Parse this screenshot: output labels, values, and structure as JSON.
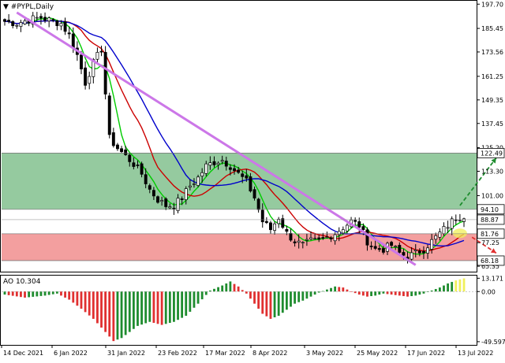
{
  "chart_data": [
    {
      "type": "candlestick",
      "title": "▼ #PYPL,Daily",
      "ylim": [
        63.0,
        199.0
      ],
      "yticks": [
        "197.70",
        "185.45",
        "173.56",
        "161.25",
        "149.35",
        "137.45",
        "125.20",
        "113.30",
        "101.00",
        "89.10",
        "77.25",
        "65.35"
      ],
      "yticks_values": [
        197.7,
        185.45,
        173.56,
        161.25,
        149.35,
        137.45,
        125.2,
        113.3,
        101.0,
        89.1,
        77.25,
        65.35
      ],
      "price_labels": [
        {
          "label": "122.49",
          "value": 122.49,
          "color": "#ffffff",
          "text_color": "#000000"
        },
        {
          "label": "94.10",
          "value": 94.1,
          "color": "#ffffff",
          "text_color": "#000000"
        },
        {
          "label": "88.87",
          "value": 88.87,
          "color": "#ffffff",
          "text_color": "#000000"
        },
        {
          "label": "81.76",
          "value": 81.76,
          "color": "#ffffff",
          "text_color": "#000000"
        },
        {
          "label": "68.18",
          "value": 68.18,
          "color": "#ffffff",
          "text_color": "#000000"
        }
      ],
      "zones": [
        {
          "name": "resistance",
          "from": 94.1,
          "to": 122.49,
          "color": "#8fc79a"
        },
        {
          "name": "support",
          "from": 68.18,
          "to": 81.76,
          "color": "#f29a9a"
        }
      ],
      "trendline": {
        "from": [
          3,
          193.5
        ],
        "to": [
          102,
          66.0
        ],
        "color": "#cc77e8"
      },
      "forecast_arrows": [
        {
          "from": [
            113,
            96.0
          ],
          "to": [
            122,
            120.0
          ],
          "color": "#1e8c2e"
        },
        {
          "from": [
            116,
            80.0
          ],
          "to": [
            122,
            72.0
          ],
          "color": "#e03030"
        }
      ],
      "moving_averages": [
        {
          "color": "#00cc00"
        },
        {
          "color": "#cc0000"
        },
        {
          "color": "#0000cc"
        }
      ],
      "series": [
        {
          "name": "price",
          "anchors": [
            [
              0,
              189
            ],
            [
              3,
              188
            ],
            [
              6,
              190
            ],
            [
              9,
              191
            ],
            [
              12,
              189
            ],
            [
              14,
              188
            ],
            [
              16,
              182
            ],
            [
              18,
              172
            ],
            [
              20,
              158
            ],
            [
              22,
              168
            ],
            [
              24,
              175
            ],
            [
              26,
              130
            ],
            [
              28,
              125
            ],
            [
              30,
              121
            ],
            [
              32,
              117
            ],
            [
              34,
              112
            ],
            [
              36,
              104
            ],
            [
              38,
              99
            ],
            [
              40,
              96
            ],
            [
              42,
              96
            ],
            [
              44,
              100
            ],
            [
              46,
              106
            ],
            [
              48,
              110
            ],
            [
              50,
              116
            ],
            [
              52,
              118
            ],
            [
              54,
              119
            ],
            [
              56,
              116
            ],
            [
              58,
              112
            ],
            [
              60,
              108
            ],
            [
              62,
              100
            ],
            [
              64,
              88
            ],
            [
              66,
              84
            ],
            [
              68,
              90
            ],
            [
              70,
              82
            ],
            [
              72,
              78
            ],
            [
              74,
              76
            ],
            [
              76,
              78
            ],
            [
              78,
              78
            ],
            [
              80,
              80
            ],
            [
              82,
              82
            ],
            [
              84,
              85
            ],
            [
              86,
              88
            ],
            [
              88,
              86
            ],
            [
              90,
              78
            ],
            [
              92,
              74
            ],
            [
              94,
              74
            ],
            [
              96,
              76
            ],
            [
              98,
              72
            ],
            [
              100,
              70
            ],
            [
              102,
              72
            ],
            [
              104,
              74
            ],
            [
              106,
              78
            ],
            [
              108,
              82
            ],
            [
              110,
              86
            ],
            [
              112,
              90
            ],
            [
              114,
              91
            ]
          ]
        }
      ]
    },
    {
      "type": "bar",
      "title": "AO 10.304",
      "ylim": [
        -52.0,
        15.0
      ],
      "yticks": [
        "13.171",
        "0.00",
        "-49.5975"
      ],
      "yticks_values": [
        13.171,
        0.0,
        -49.5975
      ],
      "colors": {
        "up": "#1e8c2e",
        "down": "#e03030",
        "highlight": "#f0f05a"
      },
      "series": [
        {
          "anchors": [
            [
              0,
              -3
            ],
            [
              5,
              -6
            ],
            [
              10,
              -4
            ],
            [
              13,
              -2
            ],
            [
              16,
              -8
            ],
            [
              19,
              -17
            ],
            [
              22,
              -27
            ],
            [
              25,
              -40
            ],
            [
              27,
              -49
            ],
            [
              29,
              -46
            ],
            [
              31,
              -40
            ],
            [
              33,
              -34
            ],
            [
              36,
              -30
            ],
            [
              39,
              -33
            ],
            [
              42,
              -30
            ],
            [
              45,
              -24
            ],
            [
              48,
              -12
            ],
            [
              51,
              1
            ],
            [
              54,
              6
            ],
            [
              56,
              10
            ],
            [
              58,
              5
            ],
            [
              60,
              -2
            ],
            [
              62,
              -12
            ],
            [
              64,
              -22
            ],
            [
              66,
              -27
            ],
            [
              68,
              -24
            ],
            [
              70,
              -18
            ],
            [
              72,
              -12
            ],
            [
              74,
              -9
            ],
            [
              76,
              -5
            ],
            [
              78,
              -1
            ],
            [
              80,
              2
            ],
            [
              82,
              5
            ],
            [
              84,
              4
            ],
            [
              86,
              0
            ],
            [
              88,
              -3
            ],
            [
              90,
              -5
            ],
            [
              92,
              -4
            ],
            [
              94,
              -2
            ],
            [
              96,
              -3
            ],
            [
              98,
              -4
            ],
            [
              100,
              -5
            ],
            [
              102,
              -4
            ],
            [
              104,
              -2
            ],
            [
              106,
              1
            ],
            [
              108,
              4
            ],
            [
              110,
              8
            ],
            [
              112,
              11
            ],
            [
              114,
              13
            ]
          ]
        }
      ]
    }
  ],
  "xticks": [
    "14 Dec 2021",
    "6 Jan 2022",
    "31 Jan 2022",
    "23 Feb 2022",
    "17 Mar 2022",
    "8 Apr 2022",
    "3 May 2022",
    "25 May 2022",
    "17 Jun 2022",
    "13 Jul 2022"
  ],
  "xticks_positions": [
    0,
    16,
    33,
    49,
    64,
    79,
    96,
    112,
    128,
    144
  ]
}
